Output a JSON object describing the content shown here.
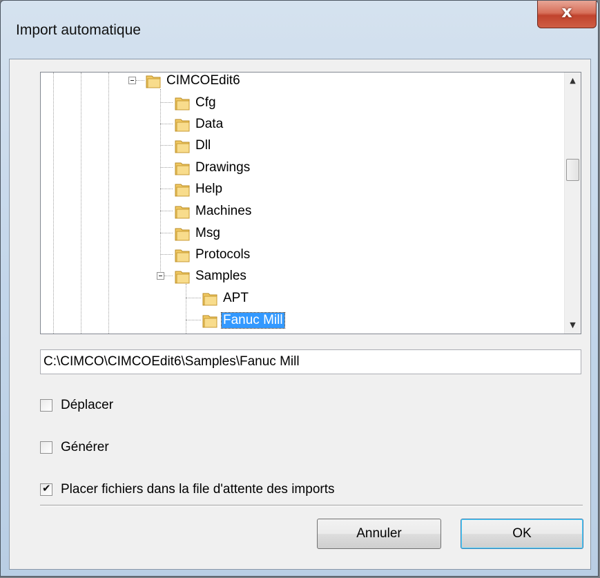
{
  "window": {
    "title": "Import automatique",
    "close_label": "x"
  },
  "tree": {
    "nodes": [
      {
        "label": "CIMCOEdit6",
        "expanded": true
      },
      {
        "label": "Cfg"
      },
      {
        "label": "Data"
      },
      {
        "label": "Dll"
      },
      {
        "label": "Drawings"
      },
      {
        "label": "Help"
      },
      {
        "label": "Machines"
      },
      {
        "label": "Msg"
      },
      {
        "label": "Protocols"
      },
      {
        "label": "Samples",
        "expanded": true
      },
      {
        "label": "APT"
      },
      {
        "label": "Fanuc Mill",
        "selected": true
      }
    ]
  },
  "path_field": {
    "value": "C:\\CIMCO\\CIMCOEdit6\\Samples\\Fanuc Mill"
  },
  "options": {
    "move_label": "Déplacer",
    "move_checked": false,
    "generate_label": "Générer",
    "generate_checked": false,
    "queue_label": "Placer fichiers dans la file d'attente des imports",
    "queue_checked": true
  },
  "buttons": {
    "cancel_label": "Annuler",
    "ok_label": "OK"
  },
  "colors": {
    "selection": "#3399ff",
    "close_button": "#c0432d",
    "folder": "#e8b84a"
  }
}
